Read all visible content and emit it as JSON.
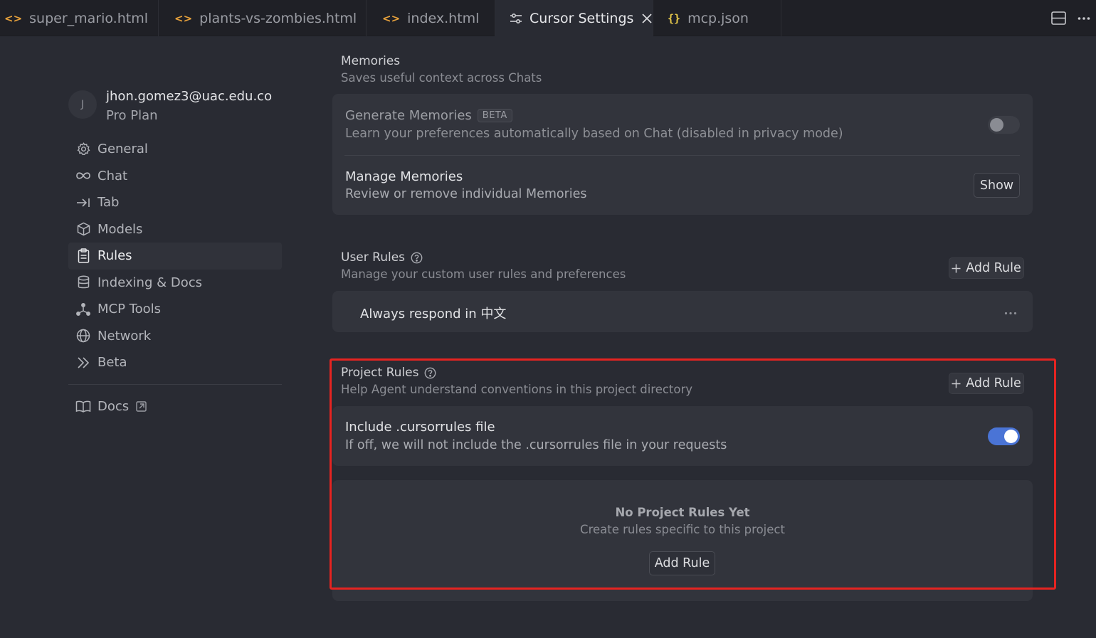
{
  "tabs": [
    {
      "label": "super_mario.html",
      "icon": "html-icon"
    },
    {
      "label": "plants-vs-zombies.html",
      "icon": "html-icon"
    },
    {
      "label": "index.html",
      "icon": "html-icon"
    },
    {
      "label": "Cursor Settings",
      "icon": "settings-sliders-icon",
      "active": true
    },
    {
      "label": "mcp.json",
      "icon": "json-icon"
    }
  ],
  "user": {
    "avatar_initial": "J",
    "email": "jhon.gomez3@uac.edu.co",
    "plan": "Pro Plan"
  },
  "nav": [
    {
      "label": "General",
      "icon": "gear-icon"
    },
    {
      "label": "Chat",
      "icon": "infinity-icon"
    },
    {
      "label": "Tab",
      "icon": "arrow-right-bar-icon"
    },
    {
      "label": "Models",
      "icon": "cube-icon"
    },
    {
      "label": "Rules",
      "icon": "clipboard-icon",
      "active": true
    },
    {
      "label": "Indexing & Docs",
      "icon": "database-icon"
    },
    {
      "label": "MCP Tools",
      "icon": "network-nodes-icon"
    },
    {
      "label": "Network",
      "icon": "globe-icon"
    },
    {
      "label": "Beta",
      "icon": "double-chevron-right-icon"
    }
  ],
  "docs": {
    "label": "Docs",
    "icon": "book-icon"
  },
  "memories": {
    "title": "Memories",
    "subtitle": "Saves useful context across Chats",
    "generate": {
      "title": "Generate Memories",
      "badge": "BETA",
      "desc": "Learn your preferences automatically based on Chat (disabled in privacy mode)",
      "enabled": false
    },
    "manage": {
      "title": "Manage Memories",
      "desc": "Review or remove individual Memories",
      "button": "Show"
    }
  },
  "user_rules": {
    "title": "User Rules",
    "subtitle": "Manage your custom user rules and preferences",
    "add_button": "Add Rule",
    "rules": [
      "Always respond in 中文"
    ]
  },
  "project_rules": {
    "title": "Project Rules",
    "subtitle": "Help Agent understand conventions in this project directory",
    "add_button": "Add Rule",
    "include": {
      "title": "Include .cursorrules file",
      "desc": "If off, we will not include the .cursorrules file in your requests",
      "enabled": true
    },
    "empty": {
      "title": "No Project Rules Yet",
      "subtitle": "Create rules specific to this project",
      "button": "Add Rule"
    }
  },
  "colors": {
    "accent": "#4a74d6",
    "highlight": "#e52421",
    "background": "#292b33"
  }
}
